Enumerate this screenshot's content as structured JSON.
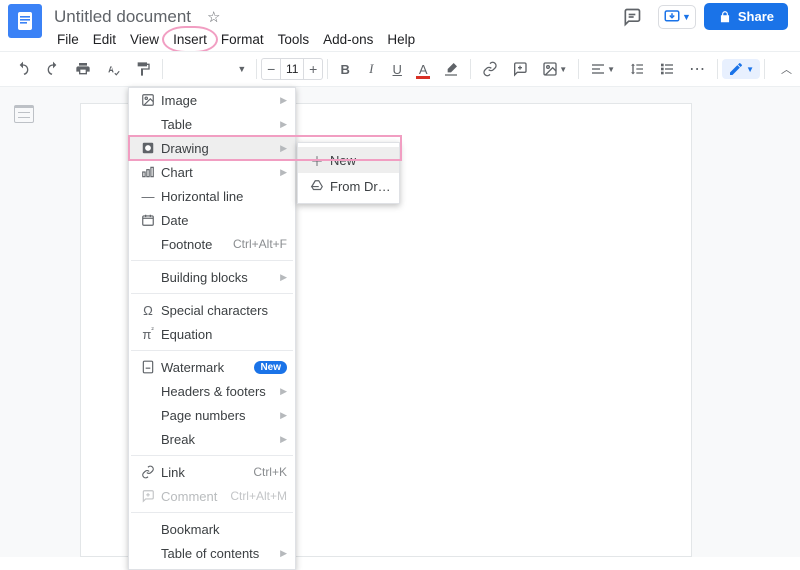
{
  "header": {
    "title": "Untitled document",
    "share_label": "Share"
  },
  "menubar": {
    "file": "File",
    "edit": "Edit",
    "view": "View",
    "insert": "Insert",
    "format": "Format",
    "tools": "Tools",
    "addons": "Add-ons",
    "help": "Help"
  },
  "toolbar": {
    "font_size": "11"
  },
  "insert_menu": {
    "image": "Image",
    "table": "Table",
    "drawing": "Drawing",
    "chart": "Chart",
    "horizontal_line": "Horizontal line",
    "date": "Date",
    "footnote": "Footnote",
    "footnote_sc": "Ctrl+Alt+F",
    "building_blocks": "Building blocks",
    "special_characters": "Special characters",
    "equation": "Equation",
    "watermark": "Watermark",
    "watermark_badge": "New",
    "headers_footers": "Headers & footers",
    "page_numbers": "Page numbers",
    "break": "Break",
    "link": "Link",
    "link_sc": "Ctrl+K",
    "comment": "Comment",
    "comment_sc": "Ctrl+Alt+M",
    "bookmark": "Bookmark",
    "toc": "Table of contents"
  },
  "drawing_submenu": {
    "new": "New",
    "from_drive": "From Drive"
  }
}
